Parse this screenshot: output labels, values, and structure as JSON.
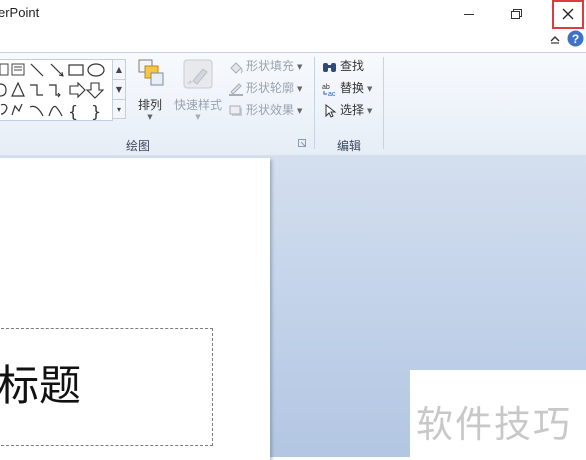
{
  "window": {
    "title": "erPoint",
    "accent_close": "#e0393e"
  },
  "ribbon": {
    "drawing_group": {
      "label": "绘图",
      "arrange_label": "排列",
      "quick_styles_label": "快速样式",
      "shape_fill_label": "形状填充",
      "shape_outline_label": "形状轮廓",
      "shape_effects_label": "形状效果"
    },
    "editing_group": {
      "label": "编辑",
      "find_label": "查找",
      "replace_label": "替换",
      "select_label": "选择"
    }
  },
  "slide": {
    "title_text": "标题"
  },
  "watermark": {
    "text": "软件技巧"
  },
  "icons": [
    "minimize-icon",
    "restore-icon",
    "close-icon",
    "ribbon-collapse-icon",
    "help-icon",
    "find-icon",
    "replace-icon",
    "select-icon",
    "shape-fill-icon",
    "shape-outline-icon",
    "shape-effects-icon",
    "arrange-icon",
    "quick-styles-icon"
  ]
}
